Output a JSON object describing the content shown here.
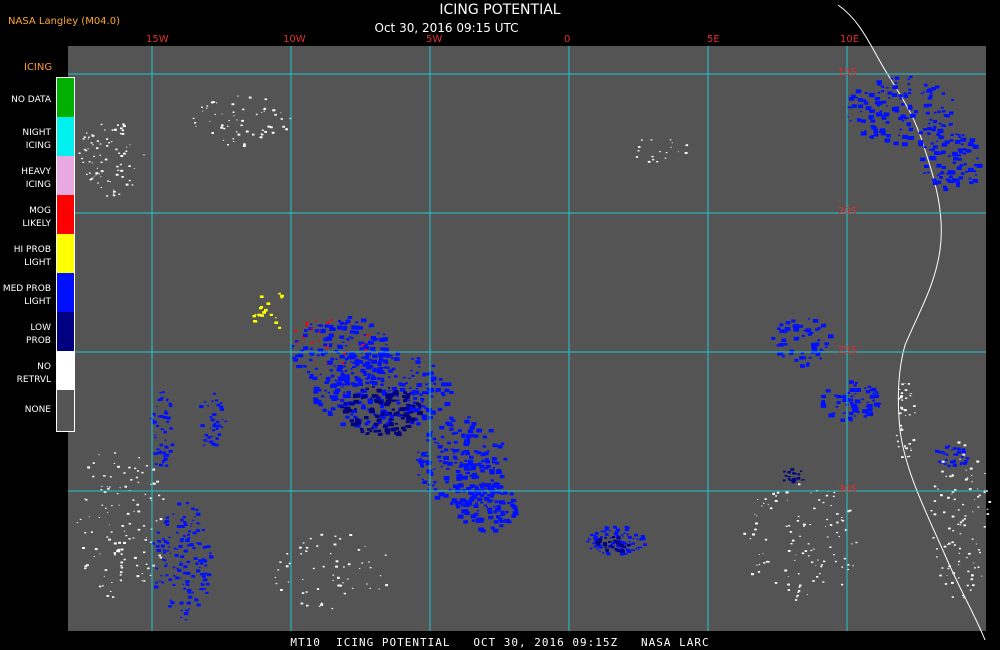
{
  "header": {
    "credit": "NASA Langley (M04.0)",
    "title": "ICING POTENTIAL",
    "subtitle": "Oct 30, 2016 09:15 UTC"
  },
  "footer": {
    "text": "MT10  ICING POTENTIAL   OCT 30, 2016 09:15Z   NASA LARC"
  },
  "legend": {
    "title": "ICING",
    "items": [
      {
        "label": "NO DATA",
        "color": "#00b000"
      },
      {
        "label": "NIGHT\nICING",
        "color": "#00f0f0"
      },
      {
        "label": "HEAVY\nICING",
        "color": "#e8a8e0"
      },
      {
        "label": "MOG\nLIKELY",
        "color": "#ff0000"
      },
      {
        "label": "HI PROB\nLIGHT",
        "color": "#ffff00"
      },
      {
        "label": "MED PROB\nLIGHT",
        "color": "#0010ff"
      },
      {
        "label": "LOW\nPROB",
        "color": "#000080"
      },
      {
        "label": "NO\nRETRVL",
        "color": "#ffffff"
      },
      {
        "label": "NONE",
        "color": "#555555"
      }
    ]
  },
  "map": {
    "background_color": "#545454",
    "grid_color": "#1fc6d0",
    "longitude_labels": [
      "15W",
      "10W",
      "5W",
      "0",
      "5E",
      "10E"
    ],
    "latitude_labels": [
      "15S",
      "20S",
      "25S",
      "30S"
    ]
  }
}
